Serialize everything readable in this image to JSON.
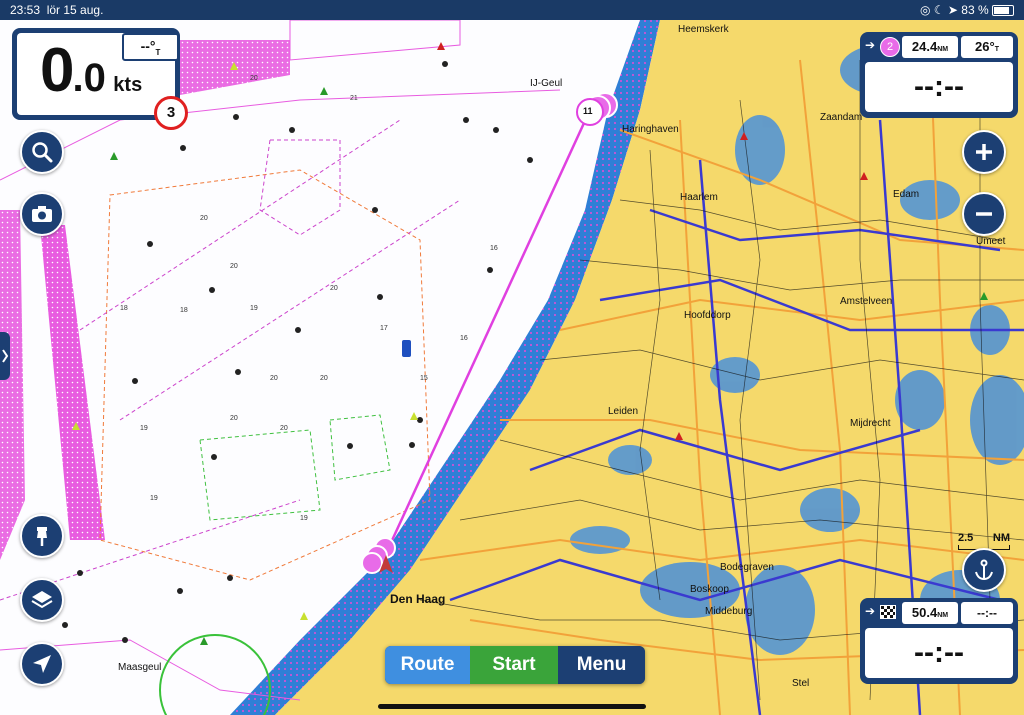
{
  "status_bar": {
    "time": "23:53",
    "date": "lör 15 aug.",
    "battery": "83 %"
  },
  "speed_panel": {
    "value_int": "0",
    "value_dec": ".0",
    "unit": "kts",
    "heading": "--°",
    "heading_suffix": "T",
    "alert_count": "3"
  },
  "nav_top": {
    "waypoint_number": "2",
    "distance": "24.4",
    "distance_unit": "NM",
    "bearing": "26°",
    "bearing_suffix": "T",
    "big_value": "--:--"
  },
  "nav_bottom": {
    "distance": "50.4",
    "distance_unit": "NM",
    "eta": "--:--",
    "big_value": "--:--"
  },
  "map": {
    "scale": "2.5",
    "scale_unit": "NM",
    "route_marker_label": "11",
    "labels": {
      "ijgeul": "IJ-Geul",
      "haringhaven": "Haringhaven",
      "heemskerk": "Heemskerk",
      "zaandam": "Zaandam",
      "haarlem": "Haarlem",
      "edam": "Edam",
      "amstelveen": "Amstelveen",
      "hoofddorp": "Hoofddorp",
      "leiden": "Leiden",
      "mijdrecht": "Mijdrecht",
      "umeet": "Umeet",
      "den_haag": "Den Haag",
      "bodegraven": "Bodegraven",
      "boskoop": "Boskoop",
      "middeburg": "Middeburg",
      "maasgeul": "Maasgeul",
      "stel": "Stel"
    }
  },
  "bottom_bar": {
    "route": "Route",
    "start": "Start",
    "menu": "Menu"
  },
  "colors": {
    "navy": "#1c3f73",
    "land": "#f5d96b",
    "water_shallow": "#4a90d9",
    "route": "#e040e0",
    "start_green": "#3aa43a",
    "route_button": "#3f8fe0",
    "alert_red": "#e02020"
  },
  "icons": [
    "search-icon",
    "camera-icon",
    "pin-icon",
    "layers-icon",
    "location-arrow-icon",
    "zoom-in-icon",
    "zoom-out-icon",
    "anchor-icon"
  ]
}
